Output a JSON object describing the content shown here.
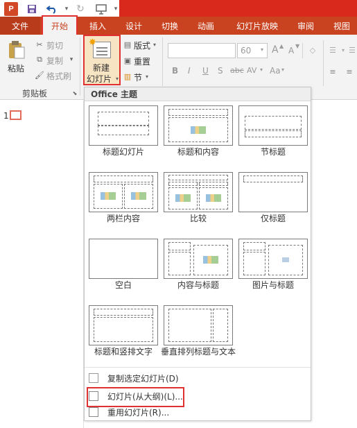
{
  "quick_access": {
    "app_icon": "P",
    "save_icon": "save-icon",
    "undo_icon": "undo-icon",
    "redo_icon": "redo-icon",
    "present_icon": "present-icon"
  },
  "tabs": [
    {
      "label": "文件"
    },
    {
      "label": "开始"
    },
    {
      "label": "插入"
    },
    {
      "label": "设计"
    },
    {
      "label": "切换"
    },
    {
      "label": "动画"
    },
    {
      "label": "幻灯片放映"
    },
    {
      "label": "审阅"
    },
    {
      "label": "视图"
    }
  ],
  "ribbon": {
    "paste_label": "粘贴",
    "cut_label": "剪切",
    "copy_label": "复制",
    "format_painter_label": "格式刷",
    "clipboard_group": "剪贴板",
    "new_slide_line1": "新建",
    "new_slide_line2": "幻灯片",
    "layout_label": "版式",
    "reset_label": "重置",
    "section_label": "节",
    "font_size": "60",
    "bold": "B",
    "italic": "I",
    "underline": "U",
    "strike": "S",
    "shadow": "abc",
    "spacing": "AV",
    "case": "Aa",
    "grow": "A",
    "shrink": "A"
  },
  "slides_pane": {
    "slide_number": "1"
  },
  "gallery": {
    "header": "Office 主题",
    "layouts": [
      {
        "label": "标题幻灯片"
      },
      {
        "label": "标题和内容"
      },
      {
        "label": "节标题"
      },
      {
        "label": "两栏内容"
      },
      {
        "label": "比较"
      },
      {
        "label": "仅标题"
      },
      {
        "label": "空白"
      },
      {
        "label": "内容与标题"
      },
      {
        "label": "图片与标题"
      },
      {
        "label": "标题和竖排文字"
      },
      {
        "label": "垂直排列标题与文本"
      }
    ],
    "menu": {
      "duplicate": "复制选定幻灯片(D)",
      "outline": "幻灯片(从大纲)(L)...",
      "reuse": "重用幻灯片(R)..."
    }
  },
  "colors": {
    "accent": "#c94321",
    "titlebar_red": "#d9291c",
    "highlight_box": "#e03030"
  }
}
